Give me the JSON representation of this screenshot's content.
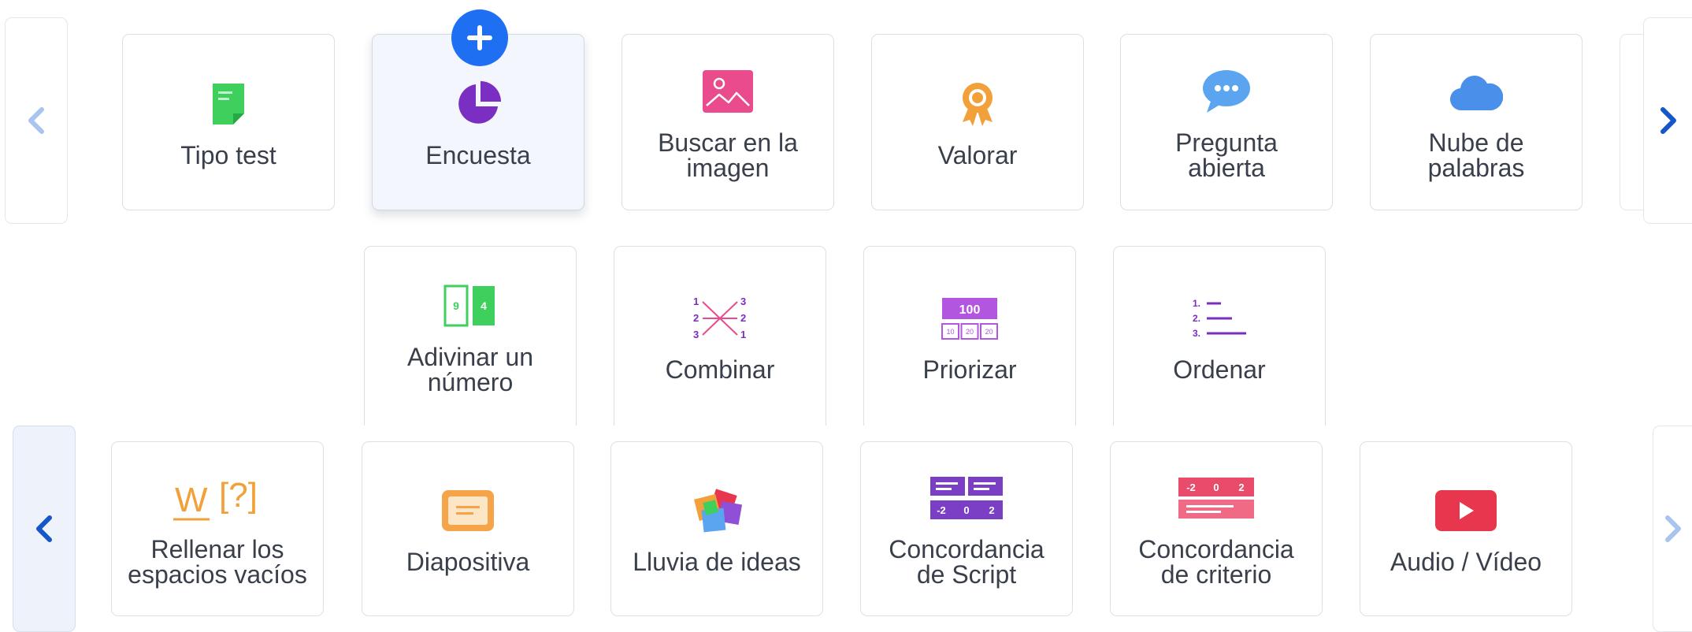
{
  "row1": {
    "items": [
      {
        "label": "Tipo test",
        "icon": "document-icon"
      },
      {
        "label": "Encuesta",
        "icon": "pie-chart-icon"
      },
      {
        "label": "Buscar en la\nimagen",
        "icon": "image-icon"
      },
      {
        "label": "Valorar",
        "icon": "award-icon"
      },
      {
        "label": "Pregunta\nabierta",
        "icon": "chat-bubble-icon"
      },
      {
        "label": "Nube de\npalabras",
        "icon": "cloud-icon"
      }
    ]
  },
  "row2": {
    "items": [
      {
        "label": "Adivinar un\nnúmero",
        "icon": "number-cards-icon",
        "icon_text": [
          "9",
          "4"
        ]
      },
      {
        "label": "Combinar",
        "icon": "match-icon",
        "icon_text": [
          "1",
          "2",
          "3",
          "3",
          "2",
          "1"
        ]
      },
      {
        "label": "Priorizar",
        "icon": "prioritize-icon",
        "icon_text": [
          "100",
          "10",
          "20",
          "20"
        ]
      },
      {
        "label": "Ordenar",
        "icon": "ordered-list-icon",
        "icon_text": [
          "1.",
          "2.",
          "3."
        ]
      }
    ]
  },
  "row3": {
    "items": [
      {
        "label": "Rellenar los\nespacios vacíos",
        "icon": "fill-blanks-icon",
        "icon_text": [
          "W",
          "[?]"
        ]
      },
      {
        "label": "Diapositiva",
        "icon": "slide-icon"
      },
      {
        "label": "Lluvia de ideas",
        "icon": "brainstorm-icon"
      },
      {
        "label": "Concordancia\nde Script",
        "icon": "script-match-icon",
        "icon_text": [
          "-2",
          "0",
          "2"
        ]
      },
      {
        "label": "Concordancia\nde criterio",
        "icon": "criteria-match-icon",
        "icon_text": [
          "-2",
          "0",
          "2"
        ]
      },
      {
        "label": "Audio / Vídeo",
        "icon": "play-icon"
      }
    ]
  },
  "colors": {
    "accent_blue": "#1f6ff2",
    "chevron_light": "#a9c4ee",
    "chevron_dark": "#1557c9",
    "green": "#3ecf5c",
    "purple": "#7a2fc2",
    "pink": "#e94b8c",
    "orange": "#f2a13a",
    "sky": "#5aa4f0",
    "violet": "#b256e0",
    "red": "#e8364f"
  }
}
